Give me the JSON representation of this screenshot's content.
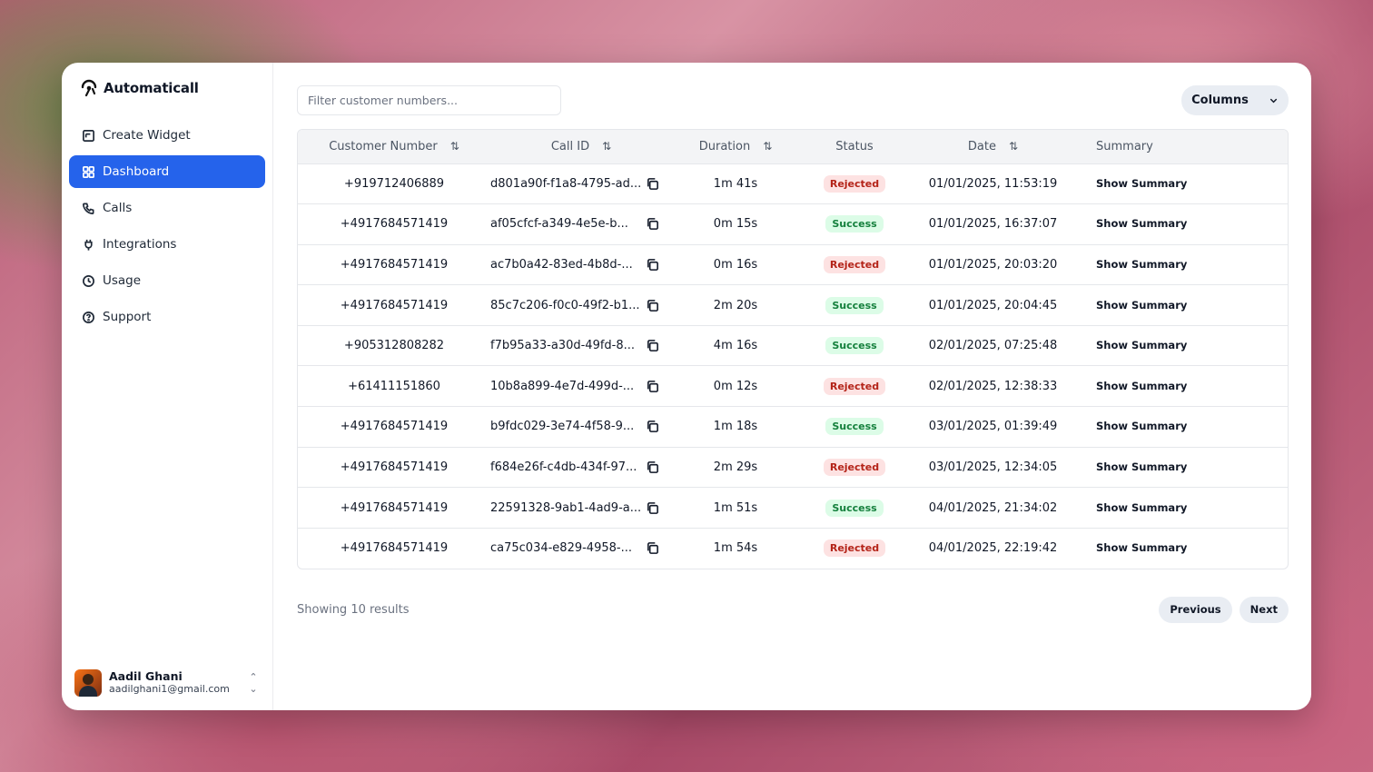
{
  "app": {
    "name": "Automaticall"
  },
  "sidebar": {
    "items": [
      {
        "label": "Create Widget",
        "icon": "widget-icon",
        "active": false
      },
      {
        "label": "Dashboard",
        "icon": "dashboard-grid-icon",
        "active": true
      },
      {
        "label": "Calls",
        "icon": "phone-icon",
        "active": false
      },
      {
        "label": "Integrations",
        "icon": "plug-icon",
        "active": false
      },
      {
        "label": "Usage",
        "icon": "clock-icon",
        "active": false
      },
      {
        "label": "Support",
        "icon": "help-circle-icon",
        "active": false
      }
    ]
  },
  "user": {
    "name": "Aadil Ghani",
    "email": "aadilghani1@gmail.com"
  },
  "toolbar": {
    "filter_placeholder": "Filter customer numbers...",
    "columns_label": "Columns"
  },
  "table": {
    "headers": {
      "customer_number": "Customer Number",
      "call_id": "Call ID",
      "duration": "Duration",
      "status": "Status",
      "date": "Date",
      "summary": "Summary"
    },
    "rows": [
      {
        "number": "+919712406889",
        "call_id": "d801a90f-f1a8-4795-ad...",
        "duration": "1m 41s",
        "status": "Rejected",
        "date": "01/01/2025, 11:53:19",
        "summary": "Show Summary"
      },
      {
        "number": "+4917684571419",
        "call_id": "af05cfcf-a349-4e5e-b...",
        "duration": "0m 15s",
        "status": "Success",
        "date": "01/01/2025, 16:37:07",
        "summary": "Show Summary"
      },
      {
        "number": "+4917684571419",
        "call_id": "ac7b0a42-83ed-4b8d-...",
        "duration": "0m 16s",
        "status": "Rejected",
        "date": "01/01/2025, 20:03:20",
        "summary": "Show Summary"
      },
      {
        "number": "+4917684571419",
        "call_id": "85c7c206-f0c0-49f2-b1...",
        "duration": "2m 20s",
        "status": "Success",
        "date": "01/01/2025, 20:04:45",
        "summary": "Show Summary"
      },
      {
        "number": "+905312808282",
        "call_id": "f7b95a33-a30d-49fd-8...",
        "duration": "4m 16s",
        "status": "Success",
        "date": "02/01/2025, 07:25:48",
        "summary": "Show Summary"
      },
      {
        "number": "+61411151860",
        "call_id": "10b8a899-4e7d-499d-...",
        "duration": "0m 12s",
        "status": "Rejected",
        "date": "02/01/2025, 12:38:33",
        "summary": "Show Summary"
      },
      {
        "number": "+4917684571419",
        "call_id": "b9fdc029-3e74-4f58-9...",
        "duration": "1m 18s",
        "status": "Success",
        "date": "03/01/2025, 01:39:49",
        "summary": "Show Summary"
      },
      {
        "number": "+4917684571419",
        "call_id": "f684e26f-c4db-434f-97...",
        "duration": "2m 29s",
        "status": "Rejected",
        "date": "03/01/2025, 12:34:05",
        "summary": "Show Summary"
      },
      {
        "number": "+4917684571419",
        "call_id": "22591328-9ab1-4ad9-a...",
        "duration": "1m 51s",
        "status": "Success",
        "date": "04/01/2025, 21:34:02",
        "summary": "Show Summary"
      },
      {
        "number": "+4917684571419",
        "call_id": "ca75c034-e829-4958-...",
        "duration": "1m 54s",
        "status": "Rejected",
        "date": "04/01/2025, 22:19:42",
        "summary": "Show Summary"
      }
    ]
  },
  "footer": {
    "result_count": "Showing 10 results",
    "previous_label": "Previous",
    "next_label": "Next"
  },
  "colors": {
    "accent": "#2563eb",
    "rejected_bg": "#fde2e2",
    "rejected_text": "#b42318",
    "success_bg": "#dcfce7",
    "success_text": "#15803d"
  }
}
